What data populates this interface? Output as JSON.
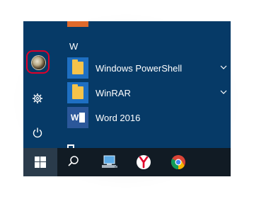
{
  "start_menu": {
    "section_letter": "W",
    "items": [
      {
        "label": "Windows PowerShell",
        "icon": "folder-icon",
        "expandable": true
      },
      {
        "label": "WinRAR",
        "icon": "folder-icon",
        "expandable": true
      },
      {
        "label": "Word 2016",
        "icon": "word-icon",
        "expandable": false
      }
    ],
    "rail": [
      "user-avatar",
      "settings-gear-icon",
      "power-icon"
    ]
  },
  "taskbar": {
    "items": [
      "windows-start-icon",
      "search-icon",
      "network-computer-icon",
      "yandex-browser-icon",
      "chrome-icon"
    ]
  },
  "colors": {
    "menu_bg": "#063a67",
    "tile_blue": "#1e6fc2",
    "word_blue": "#2b579a",
    "folder_yellow": "#f6c34a",
    "highlight_red": "#e0002a",
    "taskbar_bg": "#111b24"
  }
}
